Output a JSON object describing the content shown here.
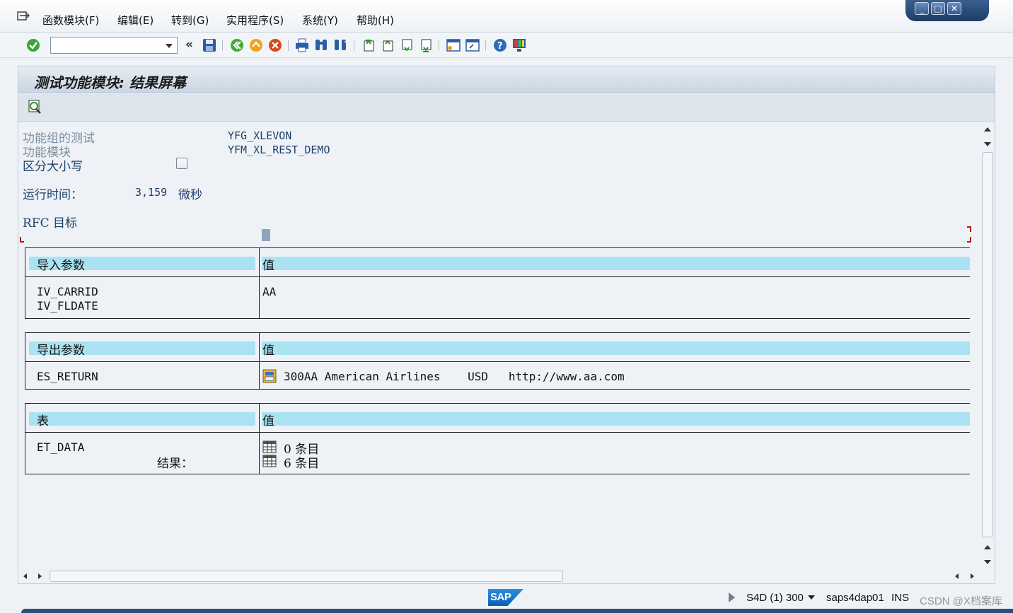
{
  "menu": {
    "items": [
      "函数模块(F)",
      "编辑(E)",
      "转到(G)",
      "实用程序(S)",
      "系统(Y)",
      "帮助(H)"
    ]
  },
  "toolbar": {
    "command_field_value": "",
    "back_symbol": "«"
  },
  "screen": {
    "title": "测试功能模块: 结果屏幕"
  },
  "info": {
    "function_group_label": "功能组的测试",
    "function_group_value": "YFG_XLEVON",
    "function_module_label": "功能模块",
    "function_module_value": "YFM_XL_REST_DEMO",
    "case_sensitive_label": "区分大小写",
    "runtime_label": "运行时间：",
    "runtime_value": "3,159",
    "runtime_unit": "微秒",
    "rfc_label": "RFC 目标"
  },
  "import_table": {
    "col1": "导入参数",
    "col2": "值",
    "rows": [
      {
        "name": "IV_CARRID",
        "value": "AA"
      },
      {
        "name": "IV_FLDATE",
        "value": ""
      }
    ]
  },
  "export_table": {
    "col1": "导出参数",
    "col2": "值",
    "row_name": "ES_RETURN",
    "row_value": "300AA American Airlines    USD   http://www.aa.com"
  },
  "tables_table": {
    "col1": "表",
    "col2": "值",
    "row_name": "ET_DATA",
    "result_label": "结果：",
    "entries_before": "0 条目",
    "entries_after": "6 条目"
  },
  "status": {
    "system": "S4D (1) 300",
    "server": "saps4dap01",
    "mode": "INS",
    "logo": "SAP"
  },
  "watermark": "CSDN @X档案库",
  "colors": {
    "header_cyan": "#a9e3f2",
    "label_grey": "#7c8f9f",
    "value_blue": "#1f3f6b",
    "window_frame": "#2c4e7d"
  }
}
